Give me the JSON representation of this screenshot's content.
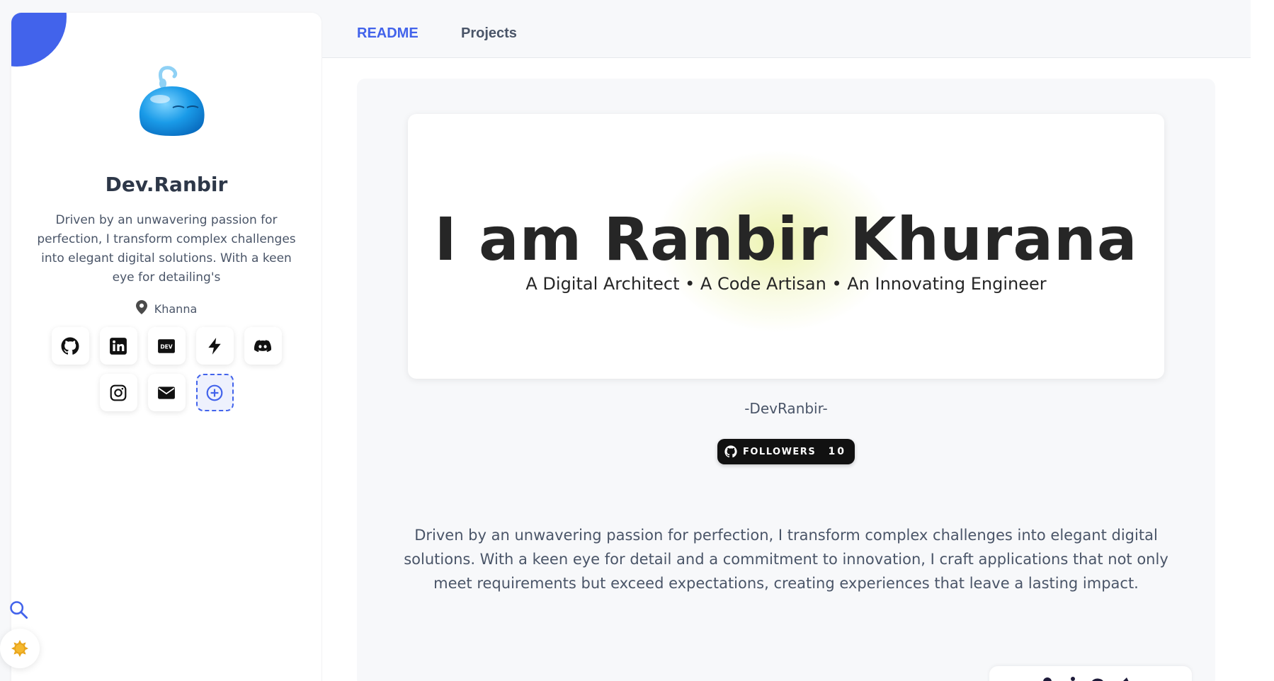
{
  "sidebar": {
    "name": "Dev.Ranbir",
    "bio": "Driven by an unwavering passion for perfection, I transform complex challenges into elegant digital solutions. With a keen eye for detailing's",
    "location": "Khanna",
    "socials": [
      {
        "icon": "github-icon"
      },
      {
        "icon": "linkedin-icon"
      },
      {
        "icon": "dev-icon"
      },
      {
        "icon": "bolt-icon"
      },
      {
        "icon": "discord-icon"
      },
      {
        "icon": "instagram-icon"
      },
      {
        "icon": "mail-icon"
      },
      {
        "icon": "plus-circle-icon"
      }
    ]
  },
  "tabs": [
    {
      "label": "README",
      "active": true
    },
    {
      "label": "Projects",
      "active": false
    }
  ],
  "readme": {
    "hero_title": "I am Ranbir Khurana",
    "hero_subtitle": "A Digital Architect • A Code Artisan • An Innovating Engineer",
    "handle": "-DevRanbir-",
    "followers_label": "FOLLOWERS",
    "followers_count": "10",
    "about": "Driven by an unwavering passion for perfection, I transform complex challenges into elegant digital solutions. With a keen eye for detail and a commitment to innovation, I craft applications that not only meet requirements but exceed expectations, creating experiences that leave a lasting impact."
  },
  "colors": {
    "accent": "#4263eb",
    "text_dark": "#2d3748",
    "background": "#f7f8fa",
    "badge_bg": "#111111"
  }
}
